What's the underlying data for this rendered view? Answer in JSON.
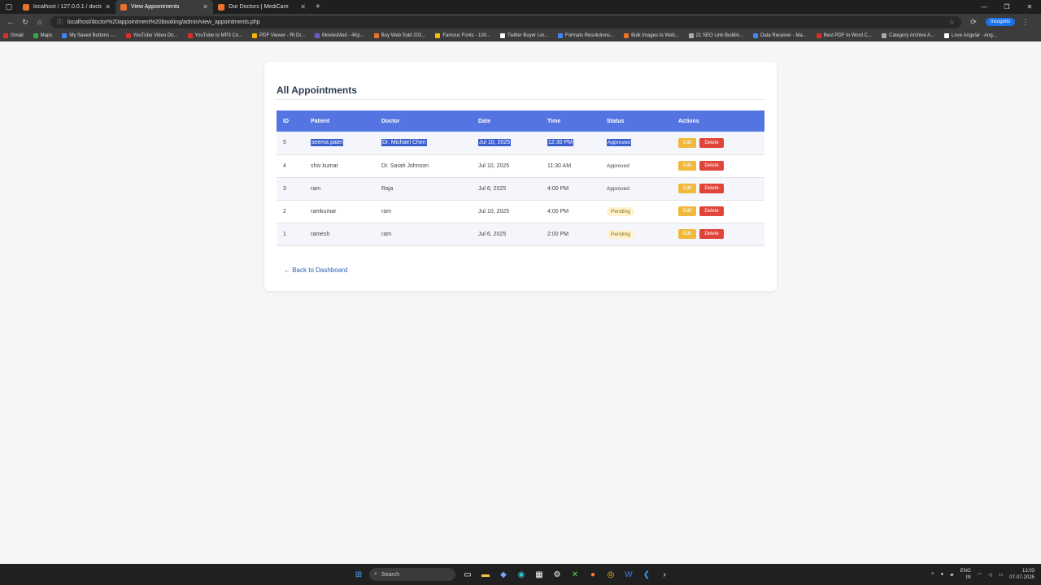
{
  "browser": {
    "tabs": [
      {
        "label": "localhost / 127.0.0.1 / doctor app"
      },
      {
        "label": "View Appointments"
      },
      {
        "label": "Our Doctors | MediCare"
      }
    ],
    "new_tab": "+",
    "url": "localhost/doctor%20appointment%20booking/admin/view_appointments.php",
    "profile_label": "Incognito",
    "bookmarks": [
      "Gmail",
      "Maps",
      "My Saved Buttons -...",
      "YouTube Video Do...",
      "YouTube to MP3 Co...",
      "PDF Viewer - Rt Dr...",
      "MoviesMod - 4Kp...",
      "Buy Web Sold 202...",
      "Famous Fonts - 100...",
      "Twitter Buyer Lor...",
      "Formats Resolutions...",
      "Bulk Images to Web...",
      "21 SEO Link Buildin...",
      "Data Receiver - Ma...",
      "Best PDF to Word C...",
      "Category Archive A...",
      "Love Angular - Ang..."
    ]
  },
  "page": {
    "title": "All Appointments",
    "columns": [
      "ID",
      "Patient",
      "Doctor",
      "Date",
      "Time",
      "Status",
      "Actions"
    ],
    "rows": [
      {
        "id": "5",
        "patient": "seema patel",
        "doctor": "Dr. Michael Chen",
        "date": "Jul 10, 2025",
        "time": "12:30 PM",
        "status": "Approved",
        "status_type": "approved",
        "selected": true
      },
      {
        "id": "4",
        "patient": "shiv kumar",
        "doctor": "Dr. Sarah Johnson",
        "date": "Jul 10, 2025",
        "time": "11:30 AM",
        "status": "Approved",
        "status_type": "approved",
        "selected": false
      },
      {
        "id": "3",
        "patient": "ram",
        "doctor": "Raja",
        "date": "Jul 6, 2025",
        "time": "4:00 PM",
        "status": "Approved",
        "status_type": "approved",
        "selected": false
      },
      {
        "id": "2",
        "patient": "ramkumar",
        "doctor": "ram",
        "date": "Jul 10, 2025",
        "time": "4:00 PM",
        "status": "Pending",
        "status_type": "pending",
        "selected": false
      },
      {
        "id": "1",
        "patient": "ramesh",
        "doctor": "ram",
        "date": "Jul 6, 2025",
        "time": "2:00 PM",
        "status": "Pending",
        "status_type": "pending",
        "selected": false
      }
    ],
    "edit_label": "Edit",
    "delete_label": "Delete",
    "back_link": "← Back to Dashboard",
    "colors": {
      "header": "#5474e2",
      "edit": "#f0b93c",
      "delete": "#e0453a",
      "pending_bg": "#fff3cd"
    }
  },
  "taskbar": {
    "search_placeholder": "Search",
    "lang": "ENG",
    "region": "IN",
    "time": "13:03",
    "date": "07-07-2025"
  }
}
